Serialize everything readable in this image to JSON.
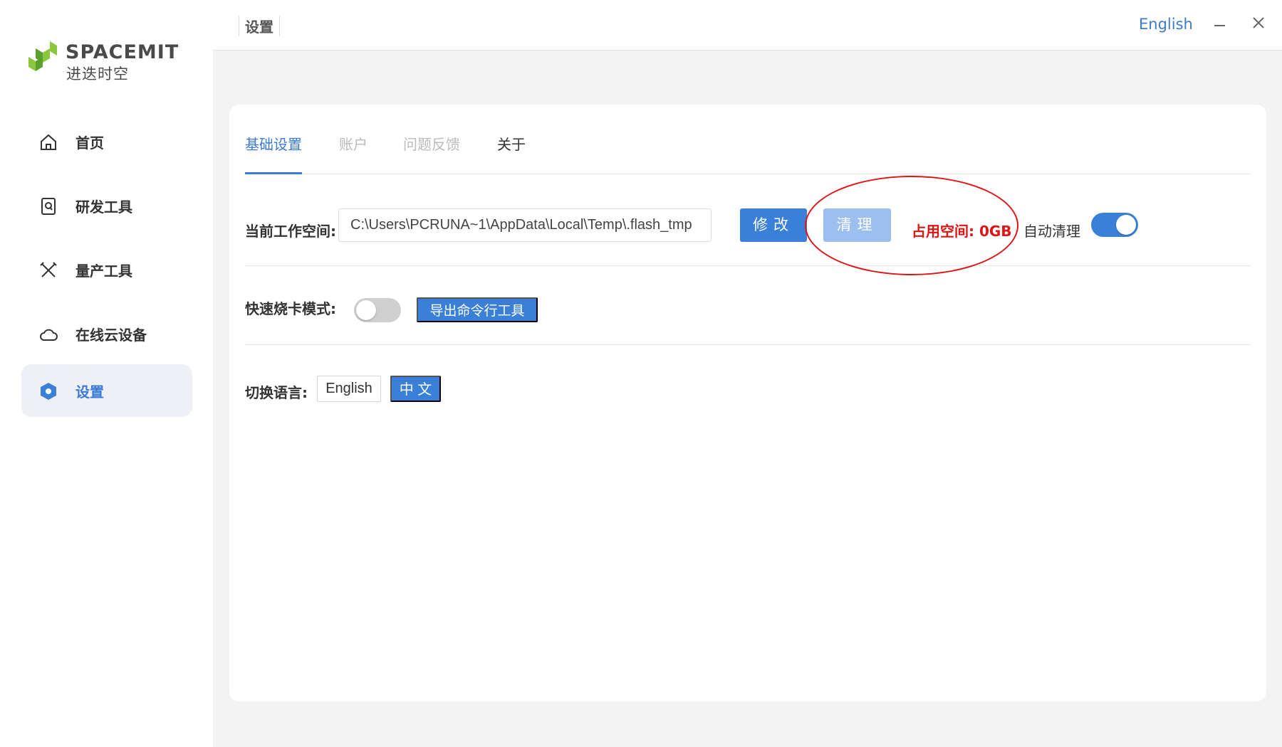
{
  "brand": {
    "name": "SPACEMIT",
    "name_cn": "进迭时空",
    "colors": {
      "green": "#8cc63f",
      "dark_green": "#5aa02c"
    }
  },
  "sidebar": {
    "items": [
      {
        "label": "首页",
        "icon": "home-icon",
        "active": false
      },
      {
        "label": "研发工具",
        "icon": "dev-tool-icon",
        "active": false
      },
      {
        "label": "量产工具",
        "icon": "tools-icon",
        "active": false
      },
      {
        "label": "在线云设备",
        "icon": "cloud-icon",
        "active": false
      },
      {
        "label": "设置",
        "icon": "settings-hexagon-icon",
        "active": true
      }
    ]
  },
  "header": {
    "title": "设置",
    "language_link": "English",
    "minimize_icon": "minimize-icon",
    "close_icon": "close-icon"
  },
  "tabs": [
    {
      "label": "基础设置",
      "state": "active"
    },
    {
      "label": "账户",
      "state": "disabled"
    },
    {
      "label": "问题反馈",
      "state": "disabled"
    },
    {
      "label": "关于",
      "state": "normal"
    }
  ],
  "workspace": {
    "label": "当前工作空间:",
    "path": "C:\\Users\\PCRUNA~1\\AppData\\Local\\Temp\\.flash_tmp",
    "modify_button": "修改",
    "clean_button": "清理",
    "occupied": "占用空间: 0GB",
    "auto_clean_label": "自动清理",
    "auto_clean_on": true
  },
  "fast_flash": {
    "label": "快速烧卡模式:",
    "enabled": false,
    "export_button": "导出命令行工具"
  },
  "language": {
    "label": "切换语言:",
    "options": [
      "English",
      "中 文"
    ],
    "selected": "中 文"
  },
  "theme": {
    "accent": "#3a80d8",
    "warning": "#e01414",
    "annotation": "#e01414"
  }
}
